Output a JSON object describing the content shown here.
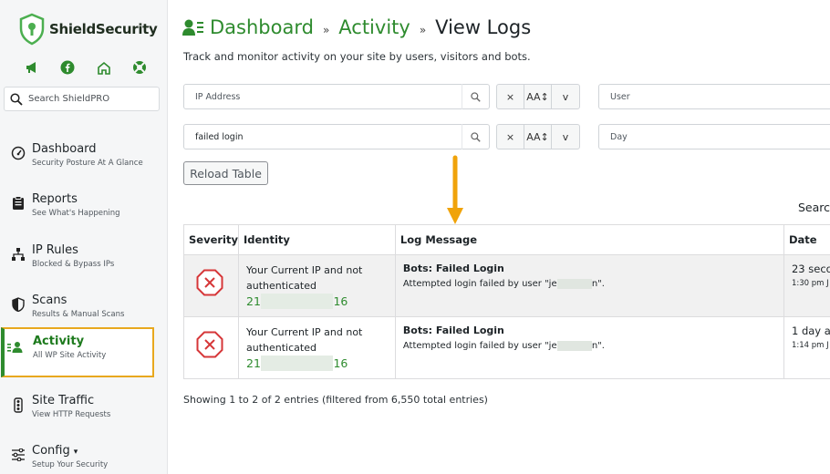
{
  "brand": {
    "name": "ShieldSecurity"
  },
  "sidebar": {
    "search_placeholder": "Search ShieldPRO",
    "items": [
      {
        "title": "Dashboard",
        "sub": "Security Posture At A Glance"
      },
      {
        "title": "Reports",
        "sub": "See What's Happening"
      },
      {
        "title": "IP Rules",
        "sub": "Blocked & Bypass IPs"
      },
      {
        "title": "Scans",
        "sub": "Results & Manual Scans"
      },
      {
        "title": "Activity",
        "sub": "All WP Site Activity"
      },
      {
        "title": "Site Traffic",
        "sub": "View HTTP Requests"
      },
      {
        "title": "Config",
        "sub": "Setup Your Security"
      }
    ],
    "config_caret": "▾"
  },
  "breadcrumb": {
    "first": "Dashboard",
    "second": "Activity",
    "current": "View Logs",
    "sep": "»"
  },
  "subtitle": "Track and monitor activity on your site by users, visitors and bots.",
  "filters": {
    "ip_placeholder": "IP Address",
    "message_value": "failed login",
    "user_placeholder": "User",
    "day_placeholder": "Day",
    "clear_label": "×",
    "case_label": "AA↕",
    "toggle_label": "v"
  },
  "reload_label": "Reload Table",
  "search_label": "Search",
  "table": {
    "headers": [
      "Severity",
      "Identity",
      "Log Message",
      "Date"
    ],
    "rows": [
      {
        "identity_line1": "Your Current IP and not",
        "identity_line2": "authenticated",
        "ip_start": "21",
        "ip_end": "16",
        "title": "Bots: Failed Login",
        "message_prefix": "Attempted login failed by user \"je",
        "message_suffix": "n\".",
        "date": "23 secon",
        "time": "1:30 pm J"
      },
      {
        "identity_line1": "Your Current IP and not",
        "identity_line2": "authenticated",
        "ip_start": "21",
        "ip_end": "16",
        "title": "Bots: Failed Login",
        "message_prefix": "Attempted login failed by user \"je",
        "message_suffix": "n\".",
        "date": "1 day ag",
        "time": "1:14 pm J"
      }
    ]
  },
  "info": "Showing 1 to 2 of 2 entries (filtered from 6,550 total entries)",
  "colors": {
    "brand_green": "#2e8b2e",
    "highlight": "#e8a81e",
    "severity_red": "#d63638"
  }
}
